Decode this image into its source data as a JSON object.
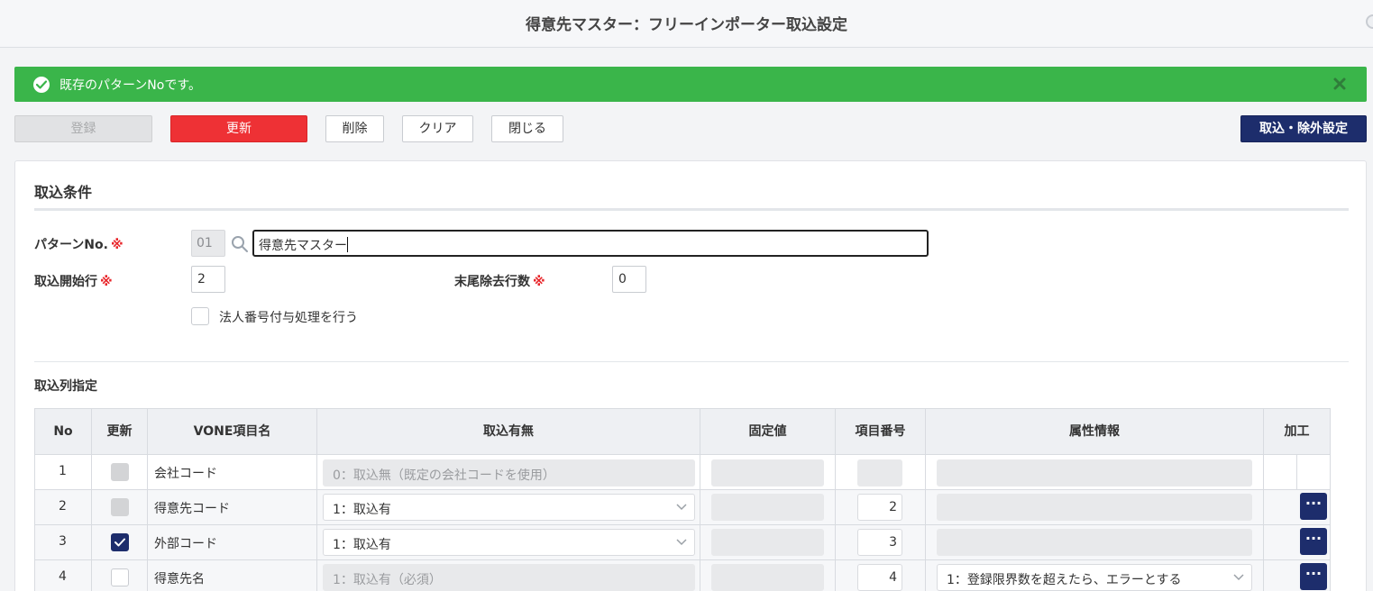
{
  "window": {
    "title": "得意先マスター：フリーインポーター取込設定"
  },
  "alert": {
    "message": "既存のパターンNoです。",
    "color": "#3ab54a"
  },
  "toolbar": {
    "register": "登録",
    "update": "更新",
    "delete": "削除",
    "clear": "クリア",
    "close": "閉じる",
    "import_exclude": "取込・除外設定"
  },
  "conditions": {
    "title": "取込条件",
    "pattern_label": "パターンNo.",
    "required_mark": "※",
    "pattern_no": "01",
    "pattern_name": "得意先マスター",
    "start_row_label": "取込開始行",
    "start_row": "2",
    "tail_rows_label": "末尾除去行数",
    "tail_rows": "0",
    "corp_number_label": "法人番号付与処理を行う",
    "corp_number_checked": false
  },
  "columns": {
    "title": "取込列指定",
    "headers": [
      "No",
      "更新",
      "VONE項目名",
      "取込有無",
      "固定値",
      "項目番号",
      "属性情報",
      "加工"
    ],
    "rows": [
      {
        "no": "1",
        "update": "disabled",
        "name": "会社コード",
        "import": "0：取込無（既定の会社コードを使用）",
        "import_editable": false,
        "fixed": "",
        "item_no": "",
        "attr": "",
        "attr_editable": false,
        "has_more": false
      },
      {
        "no": "2",
        "update": "disabled",
        "name": "得意先コード",
        "import": "1：取込有",
        "import_editable": true,
        "fixed": "",
        "item_no": "2",
        "attr": "",
        "attr_editable": false,
        "has_more": true
      },
      {
        "no": "3",
        "update": "checked",
        "name": "外部コード",
        "import": "1：取込有",
        "import_editable": true,
        "fixed": "",
        "item_no": "3",
        "attr": "",
        "attr_editable": false,
        "has_more": true
      },
      {
        "no": "4",
        "update": "unchecked",
        "name": "得意先名",
        "import": "1：取込有（必須）",
        "import_editable": false,
        "fixed": "",
        "item_no": "4",
        "attr": "1：登録限界数を超えたら、エラーとする",
        "attr_editable": true,
        "has_more": true
      }
    ],
    "more_label": "···"
  },
  "colors": {
    "navy": "#1d2d6c",
    "red": "#ee3135",
    "success": "#3ab54a"
  }
}
